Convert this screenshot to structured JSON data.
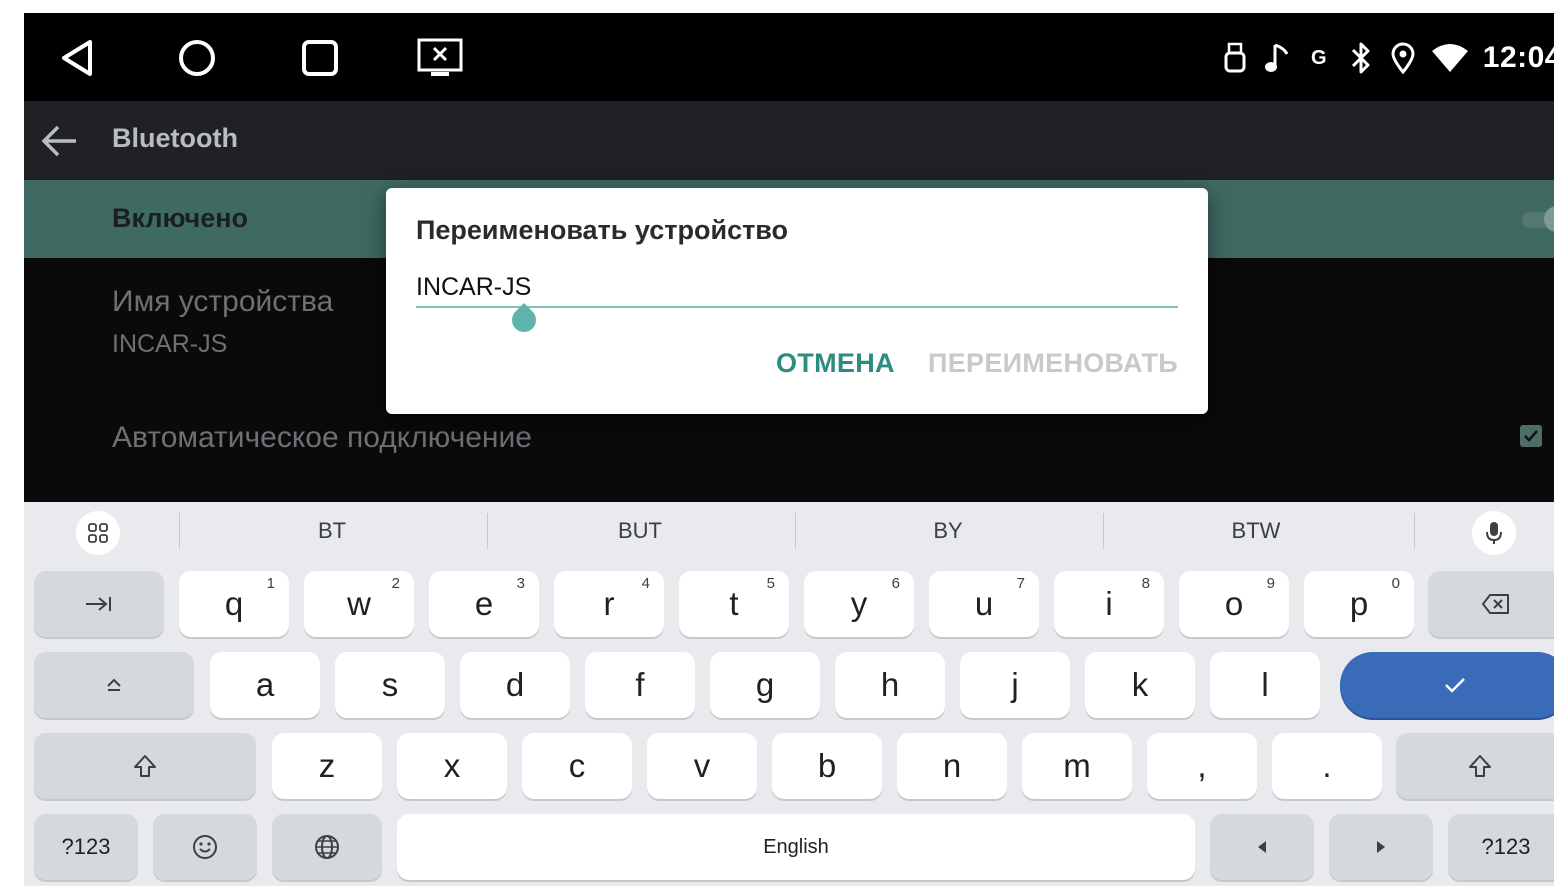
{
  "status": {
    "time": "12:04"
  },
  "appbar": {
    "title": "Bluetooth"
  },
  "settings": {
    "enabled_label": "Включено",
    "device_name_title": "Имя устройства",
    "device_name_value": "INCAR-JS",
    "auto_connect_label": "Автоматическое подключение"
  },
  "dialog": {
    "title": "Переименовать устройство",
    "input_value": "INCAR-JS",
    "cancel_label": "ОТМЕНА",
    "rename_label": "ПЕРЕИМЕНОВАТЬ"
  },
  "keyboard": {
    "suggestions": [
      "BT",
      "BUT",
      "BY",
      "BTW"
    ],
    "row1": [
      {
        "label": "q",
        "hint": "1"
      },
      {
        "label": "w",
        "hint": "2"
      },
      {
        "label": "e",
        "hint": "3"
      },
      {
        "label": "r",
        "hint": "4"
      },
      {
        "label": "t",
        "hint": "5"
      },
      {
        "label": "y",
        "hint": "6"
      },
      {
        "label": "u",
        "hint": "7"
      },
      {
        "label": "i",
        "hint": "8"
      },
      {
        "label": "o",
        "hint": "9"
      },
      {
        "label": "p",
        "hint": "0"
      }
    ],
    "row2": [
      "a",
      "s",
      "d",
      "f",
      "g",
      "h",
      "j",
      "k",
      "l"
    ],
    "row3": [
      "z",
      "x",
      "c",
      "v",
      "b",
      "n",
      "m",
      ",",
      "."
    ],
    "symbols_label": "?123",
    "space_label": "English",
    "accent_color": "#3a6bb8"
  }
}
